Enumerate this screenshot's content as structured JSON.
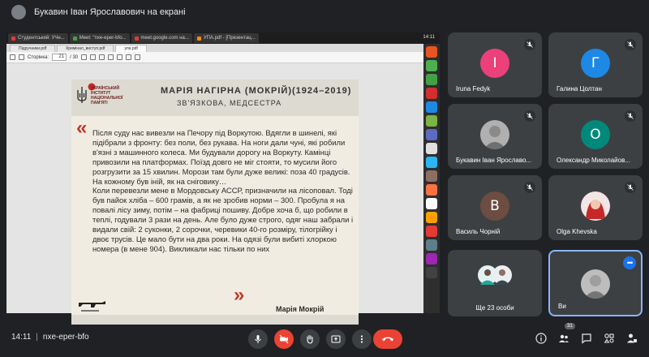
{
  "presenter": {
    "label": "Букавин Іван Ярославович на екрані"
  },
  "os": {
    "tabs": [
      "Студентський: УЧн...",
      "Meet: \"nxe-eper-bfo...",
      "meet.google.com на...",
      "УПА.pdf - [Презентац..."
    ],
    "clock": "14:11"
  },
  "viewer": {
    "doc_tabs": [
      "Підручники.pdf",
      "Кримінал_виступ.pdf",
      "упа.pdf"
    ],
    "page_label": "Сторінка:",
    "page_current": "21",
    "page_total": "/ 30"
  },
  "slide": {
    "org_name": "УКРАЇНСЬКИЙ ІНСТИТУТ НАЦІОНАЛЬНОЇ ПАМ'ЯТІ",
    "title": "МАРІЯ НАГІРНА (МОКРІЙ)(1924–2019)",
    "subtitle": "ЗВ'ЯЗКОВА, МЕДСЕСТРА",
    "quote_open": "«",
    "quote_close": "»",
    "paragraph1": "Після суду нас вивезли на Печору під Воркутою. Вдягли в шинелі, які підібрали з фронту: без поли, без рукава. На ноги дали чуні, які робили в'язні з машинного колеса. Ми будували дорогу на Воркуту. Камінці привозили на платформах. Поїзд довго не міг стояти, то мусили його розгрузити за 15 хвилин. Морози там були дуже великі: поза 40 градусів. На кожному був іній, як на сніговику…",
    "paragraph2": "Коли перевезли мене в Мордовську АССР, призначили на лісоповал. Тоді був пайок хліба – 600 грамів, а як не зробив норми – 300. Пробула я на повалі лісу зиму, потім – на фабриці пошиву. Добре хоча б, що робили в теплі, годували 3 рази на день. Але було дуже строго, одяг наш забрали і видали свій: 2 суконки, 2 сорочки, черевики 40-го розміру, тілогрійку і двоє трусів. Це мало бути на два роки. На одязі були вибиті хлоркою номера (в мене 904). Викликали нас тільки по них",
    "author": "Марія Мокрій"
  },
  "participants": [
    {
      "name": "Iruna Fedyk",
      "initial": "I",
      "color": "#ec407a",
      "muted": true
    },
    {
      "name": "Галина Цолтан",
      "initial": "Г",
      "color": "#1e88e5",
      "muted": true
    },
    {
      "name": "Букавин Іван Ярославо...",
      "initial": "",
      "color": "#9e9e9e",
      "muted": true
    },
    {
      "name": "Олександр Миколайов...",
      "initial": "О",
      "color": "#00897b",
      "muted": true
    },
    {
      "name": "Василь Чорній",
      "initial": "В",
      "color": "#6d4c41",
      "muted": true
    },
    {
      "name": "Olga Khevska",
      "initial": "",
      "color": "#c62828",
      "muted": true
    },
    {
      "name": "Ще 23 особи",
      "initial": "",
      "color": "#5f6368",
      "muted": false
    },
    {
      "name": "Ви",
      "initial": "",
      "color": "#9e9e9e",
      "muted": false
    }
  ],
  "bottom": {
    "time": "14:11",
    "meeting_code": "nxe-eper-bfo",
    "participant_count": "31"
  }
}
